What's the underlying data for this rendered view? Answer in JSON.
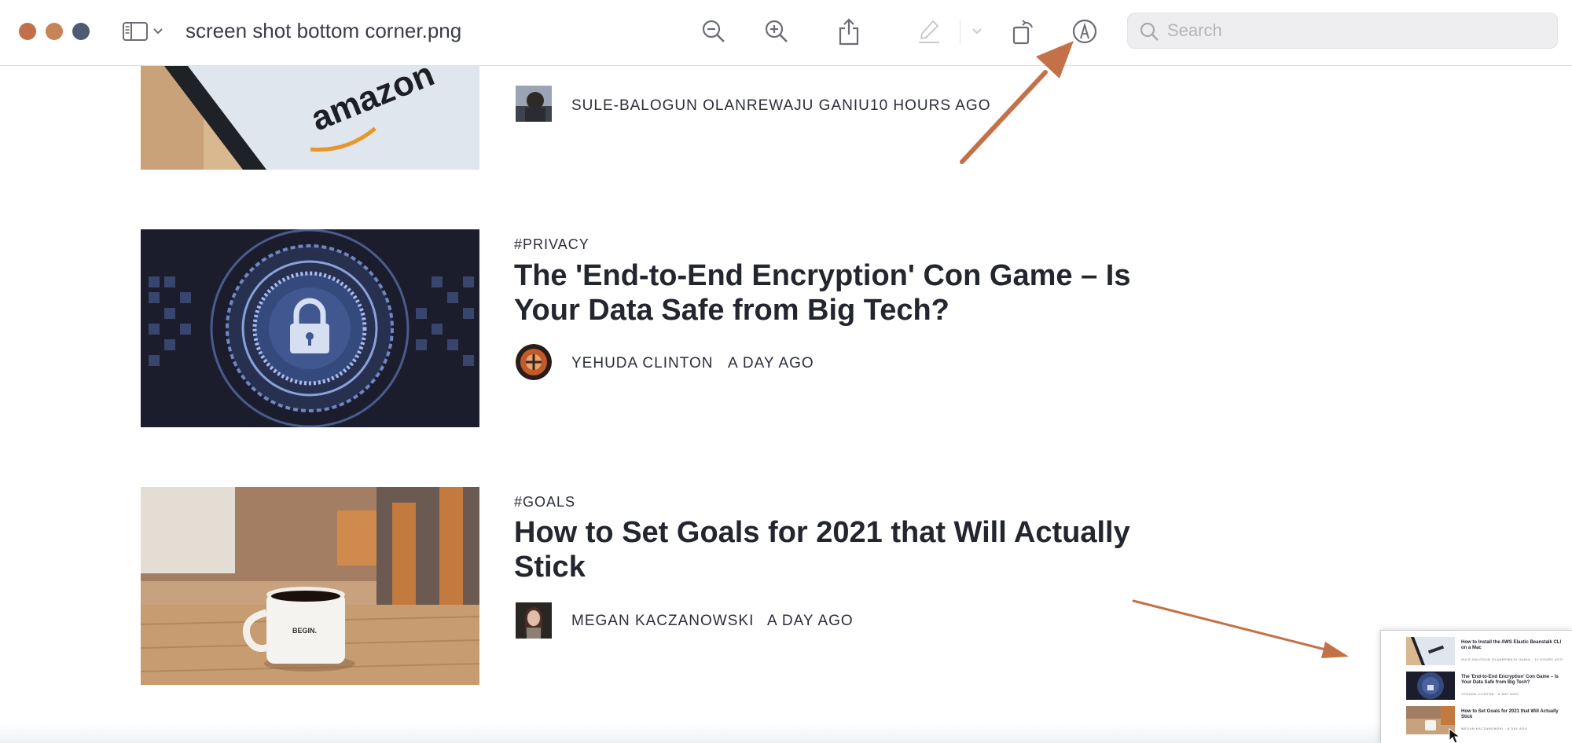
{
  "window": {
    "title": "screen shot bottom corner.png",
    "traffic_light_colors": [
      "#c46f4a",
      "#c78457",
      "#4f5b72"
    ]
  },
  "toolbar": {
    "icons": [
      "sidebar-icon",
      "chevron-down-icon",
      "zoom-out-icon",
      "zoom-in-icon",
      "share-icon",
      "highlight-icon",
      "chevron-down-icon",
      "rotate-icon",
      "markup-icon"
    ],
    "search": {
      "placeholder": "Search",
      "value": ""
    }
  },
  "articles": [
    {
      "image": "amazon-phone",
      "tag": "",
      "title": "",
      "author": "SULE-BALOGUN OLANREWAJU GANIU",
      "age": "10 HOURS AGO"
    },
    {
      "image": "encryption-lock",
      "tag": "#PRIVACY",
      "title": "The 'End-to-End Encryption' Con Game – Is Your Data Safe from Big Tech?",
      "author": "YEHUDA CLINTON",
      "age": "A DAY AGO"
    },
    {
      "image": "begin-mug",
      "tag": "#GOALS",
      "title": "How to Set Goals for 2021 that Will Actually Stick",
      "author": "MEGAN KACZANOWSKI",
      "age": "A DAY AGO"
    }
  ],
  "image_text": {
    "amazon_logo": "amazon",
    "mug_text": "BEGIN."
  },
  "annotation_color": "#c4714a",
  "preview": {
    "items": [
      {
        "title": "How to Install the AWS Elastic Beanstalk CLI on a Mac",
        "meta": "SULE-BALOGUN OLANREWAJU GANIU · 10 HOURS AGO"
      },
      {
        "title": "The 'End-to-End Encryption' Con Game – Is Your Data Safe from Big Tech?",
        "meta": "YEHUDA CLINTON · A DAY AGO"
      },
      {
        "title": "How to Set Goals for 2021 that Will Actually Stick",
        "meta": "MEGAN KACZANOWSKI · A DAY AGO"
      }
    ]
  }
}
